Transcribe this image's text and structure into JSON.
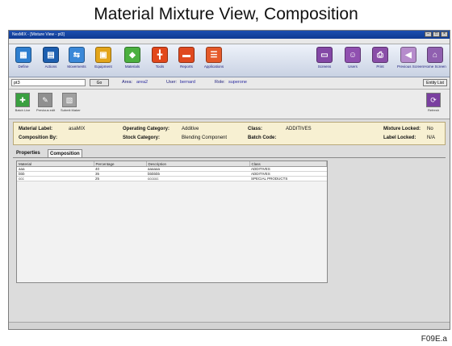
{
  "figure": {
    "title": "Material Mixture View, Composition",
    "code": "F09E.a"
  },
  "window": {
    "title": "NexMIX - [Mixture View - pt3]"
  },
  "toolbar": {
    "left": [
      {
        "label": "Define",
        "icon": "define-icon",
        "color": "#2f7fd0"
      },
      {
        "label": "Actions",
        "icon": "actions-icon",
        "color": "#1d5fb0"
      },
      {
        "label": "Movements",
        "icon": "movements-icon",
        "color": "#3a88d8"
      },
      {
        "label": "Equipment",
        "icon": "equipment-icon",
        "color": "#e3a51a"
      },
      {
        "label": "Materials",
        "icon": "materials-icon",
        "color": "#4bb040"
      },
      {
        "label": "Tools",
        "icon": "tools-icon",
        "color": "#e2481c"
      },
      {
        "label": "Reports",
        "icon": "reports-icon",
        "color": "#e04a20"
      },
      {
        "label": "Applications",
        "icon": "applications-icon",
        "color": "#e55a2a"
      }
    ],
    "right": [
      {
        "label": "Screens",
        "icon": "screens-icon",
        "color": "#8448a6"
      },
      {
        "label": "Users",
        "icon": "users-icon",
        "color": "#9050b0"
      },
      {
        "label": "Print",
        "icon": "print-icon",
        "color": "#8a4ea8"
      },
      {
        "label": "Previous Screen",
        "icon": "previous-screen-icon",
        "color": "#b68ccc"
      },
      {
        "label": "Home Screen",
        "icon": "home-screen-icon",
        "color": "#9060b0"
      }
    ]
  },
  "address": {
    "value": "pt3",
    "go_label": "Go",
    "area_label": "Area:",
    "area_value": "area2",
    "user_label": "User:",
    "user_value": "bernard",
    "role_label": "Role:",
    "role_value": "superone",
    "entity_list_label": "Entity List"
  },
  "actions": [
    {
      "label": "Batch Live",
      "icon": "batch-live-icon",
      "color": "#3aa040"
    },
    {
      "label": "Previous edit",
      "icon": "previous-edit-icon",
      "color": "#909090"
    },
    {
      "label": "Submit Maker",
      "icon": "submit-maker-icon",
      "color": "#a0a0a0"
    }
  ],
  "refresh": {
    "label": "Refresh",
    "icon": "refresh-icon",
    "color": "#7a3fa0"
  },
  "info": {
    "material_label_k": "Material Label:",
    "material_label_v": "asaMIX",
    "composition_by_k": "Composition By:",
    "composition_by_v": "",
    "operating_category_k": "Operating Category:",
    "operating_category_v": "Additive",
    "stock_category_k": "Stock Category:",
    "stock_category_v": "Blending Component",
    "class_k": "Class:",
    "class_v": "ADDITIVES",
    "batch_code_k": "Batch Code:",
    "batch_code_v": "",
    "mixture_locked_k": "Mixture Locked:",
    "mixture_locked_v": "No",
    "label_locked_k": "Label Locked:",
    "label_locked_v": "N/A"
  },
  "tabs": [
    {
      "label": "Properties",
      "active": false
    },
    {
      "label": "Composition",
      "active": true
    }
  ],
  "grid": {
    "columns": [
      "Material",
      "Percentage",
      "Description",
      "Class"
    ],
    "rows": [
      [
        "aaa",
        "40",
        "aaaaaa",
        "ADDITIVES"
      ],
      [
        "bbb",
        "35",
        "bbbbbb",
        "ADDITIVES"
      ],
      [
        "ccc",
        "25",
        "cccccc",
        "SPECIAL PRODUCTS"
      ]
    ]
  }
}
